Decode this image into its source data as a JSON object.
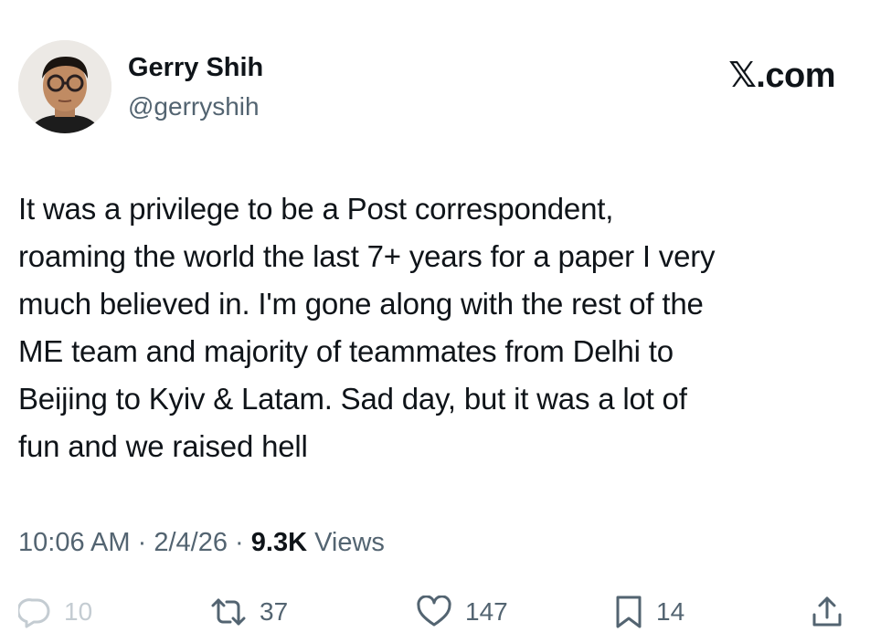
{
  "author": {
    "name": "Gerry Shih",
    "handle": "@gerryshih"
  },
  "brand": "𝕏.com",
  "tweet": {
    "lines": [
      "It was a privilege to be a Post correspondent,",
      "roaming the world the last 7+ years for a paper I very",
      "much believed in. I'm gone along with the rest of the",
      "ME team and majority of teammates from Delhi to",
      "Beijing to Kyiv & Latam. Sad day, but it was a lot of",
      "fun and we raised hell"
    ]
  },
  "meta": {
    "time": "10:06 AM",
    "separator": "·",
    "date": "2/4/26",
    "views_count": "9.3K",
    "views_label": "Views"
  },
  "actions": {
    "replies": "10",
    "reposts": "37",
    "likes": "147",
    "bookmarks": "14"
  },
  "icons": {
    "reply": "reply-icon",
    "repost": "repost-icon",
    "like": "heart-icon",
    "bookmark": "bookmark-icon",
    "share": "share-icon"
  },
  "colors": {
    "text": "#0f1419",
    "secondary": "#536471",
    "faded": "#c4ccd2"
  }
}
